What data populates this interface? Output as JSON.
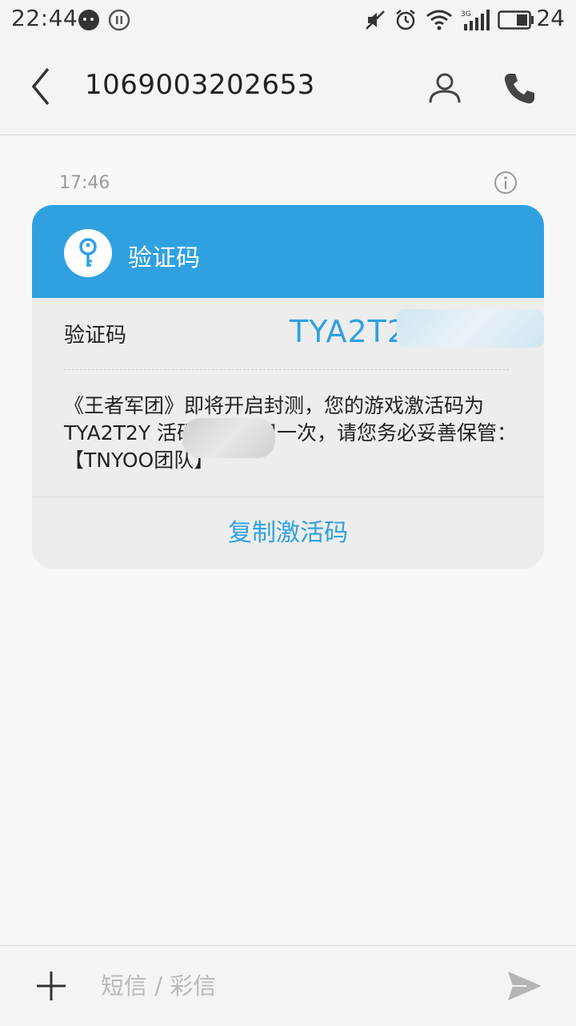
{
  "status_bar": {
    "time": "22:44",
    "battery_level": "24",
    "network": "3G"
  },
  "header": {
    "title": "1069003202653"
  },
  "message": {
    "time": "17:46",
    "card": {
      "title": "验证码",
      "code_label": "验证码",
      "code_value": "TYA2T2",
      "body": "《王者军团》即将开启封测，您的游戏激活码为TYA2T2Y         活码只能使用一次，请您务必妥善保管：【TNYOO团队】",
      "copy_label": "复制激活码"
    }
  },
  "compose": {
    "placeholder": "短信 / 彩信"
  },
  "colors": {
    "accent": "#2fa1e0",
    "card_bg": "#ededed",
    "page_bg": "#f8f8f8"
  }
}
